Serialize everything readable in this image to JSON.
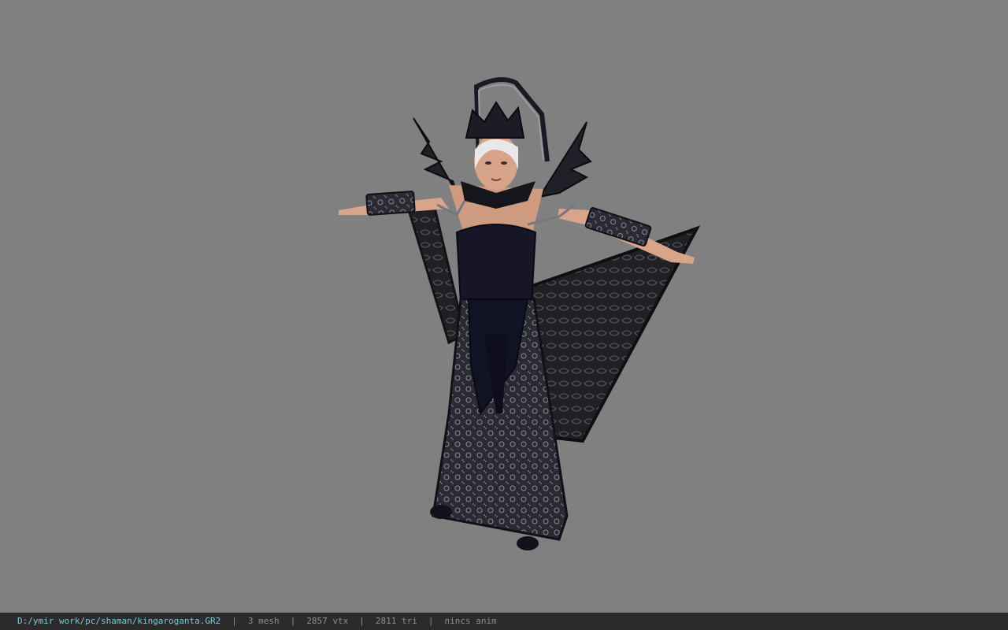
{
  "viewer": {
    "background_color": "#808080",
    "model_description": "3D character model in T-pose"
  },
  "status": {
    "file_path": "D:/ymir work/pc/shaman/kingaroganta.GR2",
    "separator": "|",
    "mesh": "3 mesh",
    "vertices": "2857 vtx",
    "triangles": "2811 tri",
    "animation": "nincs anim"
  },
  "colors": {
    "statusbar_bg": "#2b2b2b",
    "path_text": "#7fc8dc",
    "stat_text": "#8e8e8e"
  }
}
